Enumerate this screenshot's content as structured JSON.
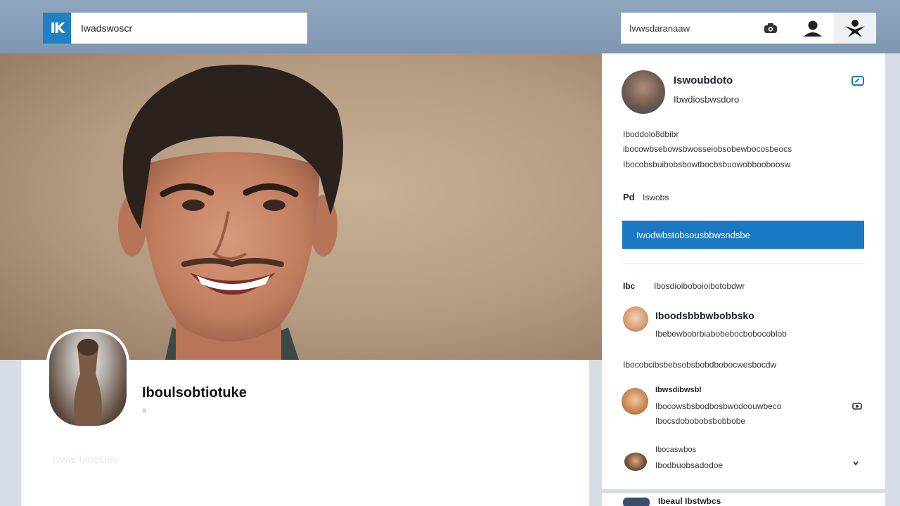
{
  "header": {
    "logo_text": "IK",
    "search_value": "Iwadswoscr",
    "actions_label": "Iwwsdaranaaw",
    "icons": [
      "camera-icon",
      "user-icon",
      "network-icon"
    ]
  },
  "profile": {
    "name": "Iboulsobtiotuke",
    "subtitle": "II",
    "meta": "Iswai bioosaw"
  },
  "sidebar": {
    "user_name": "Iswoubdoto",
    "user_title": "Ibwdiosbwsdoro",
    "about_heading": "Iboddolo8dbibr",
    "about_lines": [
      "ibocowbsebowsbwosseiobsobewbocosbeocs",
      "Ibocobsbuibobsbowtbocbsbuowobbooboosw"
    ],
    "stat_label": "Pd",
    "stat_value": "Iswobs",
    "cta_label": "Iwodwbstobsousbbwsndsbe",
    "section_prefix": "Ibc",
    "section_title": "Ibosdioiboboioibotobdwr",
    "feed": [
      {
        "name": "Iboodsbbbwbobbsko",
        "text": "Ibebewbobrbiabobebocbobocoblob"
      },
      {
        "standalone": "Ibocobcibsbebsobsbobdbobocwesbocdw"
      },
      {
        "name": "Ibwsdibwsbl",
        "text": "Ibocowsbsbodbosbwodoouwbeco",
        "text2": "Ibocsdobobobsbobbobe"
      },
      {
        "name": "Ibocaswbos",
        "text": "Ibodbuobsadodoe"
      }
    ],
    "footer_text": "Ibeaul Ibstwbcs"
  },
  "colors": {
    "brand": "#1f80c6",
    "cta": "#1b78c2",
    "topbar": "#8fa6bf"
  }
}
